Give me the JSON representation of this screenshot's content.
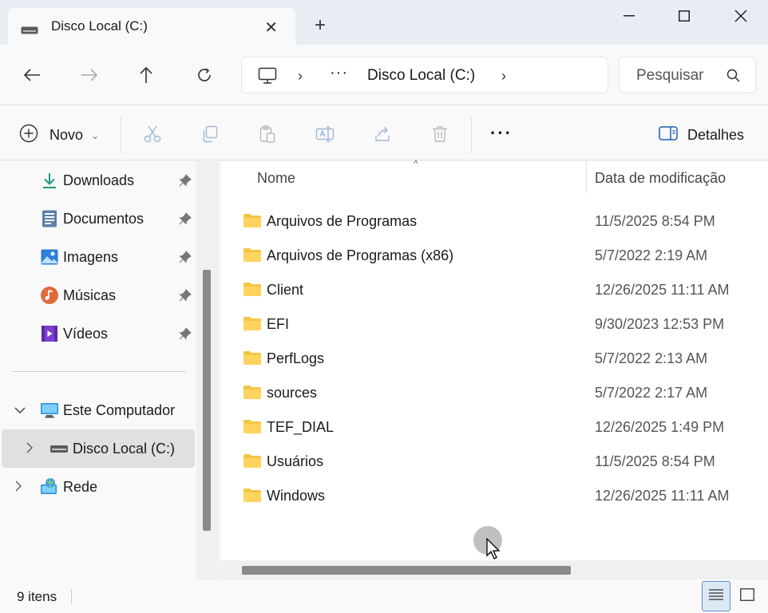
{
  "window": {
    "tab_title": "Disco Local (C:)",
    "tab_icon": "drive-icon"
  },
  "nav": {
    "address_location": "Disco Local (C:)",
    "search_placeholder": "Pesquisar"
  },
  "commandbar": {
    "new_label": "Novo",
    "details_label": "Detalhes"
  },
  "sidebar": {
    "quick_access": [
      {
        "label": "Downloads",
        "icon": "download-icon"
      },
      {
        "label": "Documentos",
        "icon": "documents-icon"
      },
      {
        "label": "Imagens",
        "icon": "pictures-icon"
      },
      {
        "label": "Músicas",
        "icon": "music-icon"
      },
      {
        "label": "Vídeos",
        "icon": "videos-icon"
      }
    ],
    "this_pc": "Este Computador",
    "local_disk": "Disco Local (C:)",
    "network": "Rede"
  },
  "list": {
    "col_name": "Nome",
    "col_date": "Data de modificação",
    "rows": [
      {
        "name": "Arquivos de Programas",
        "date": "11/5/2025 8:54 PM"
      },
      {
        "name": "Arquivos de Programas (x86)",
        "date": "5/7/2022 2:19 AM"
      },
      {
        "name": "Client",
        "date": "12/26/2025 11:11 AM"
      },
      {
        "name": "EFI",
        "date": "9/30/2023 12:53 PM"
      },
      {
        "name": "PerfLogs",
        "date": "5/7/2022 2:13 AM"
      },
      {
        "name": "sources",
        "date": "5/7/2022 2:17 AM"
      },
      {
        "name": "TEF_DIAL",
        "date": "12/26/2025 1:49 PM"
      },
      {
        "name": "Usuários",
        "date": "11/5/2025 8:54 PM"
      },
      {
        "name": "Windows",
        "date": "12/26/2025 11:11 AM"
      }
    ]
  },
  "status": {
    "item_count": "9 itens"
  },
  "colors": {
    "folder": "#f5c542",
    "accent": "#1a73c8",
    "selection": "#e0e0e0"
  }
}
